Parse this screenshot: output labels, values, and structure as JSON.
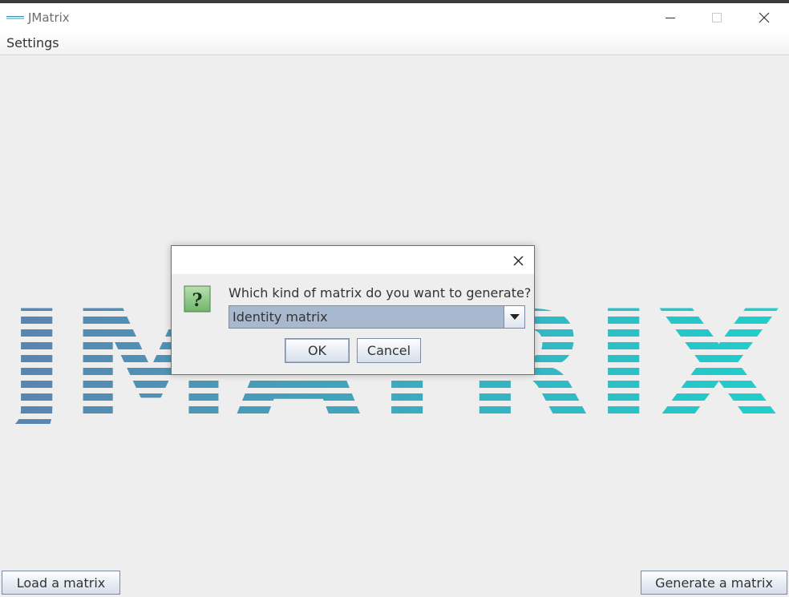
{
  "window": {
    "title": "JMatrix",
    "icon": "jmatrix-logo-icon",
    "controls": [
      "minimize-icon",
      "maximize-icon",
      "close-icon"
    ]
  },
  "menubar": {
    "items": [
      {
        "label": "Settings"
      }
    ]
  },
  "logo": {
    "text": "JMATRIX",
    "gradient_start": "#5b83b0",
    "gradient_end": "#1fd0cc"
  },
  "buttons": {
    "load": "Load a matrix",
    "generate": "Generate a matrix"
  },
  "dialog": {
    "title": "",
    "icon": "question-icon",
    "question": "Which kind of matrix do you want to generate?",
    "select": {
      "value": "Identity matrix"
    },
    "ok": "OK",
    "cancel": "Cancel"
  }
}
